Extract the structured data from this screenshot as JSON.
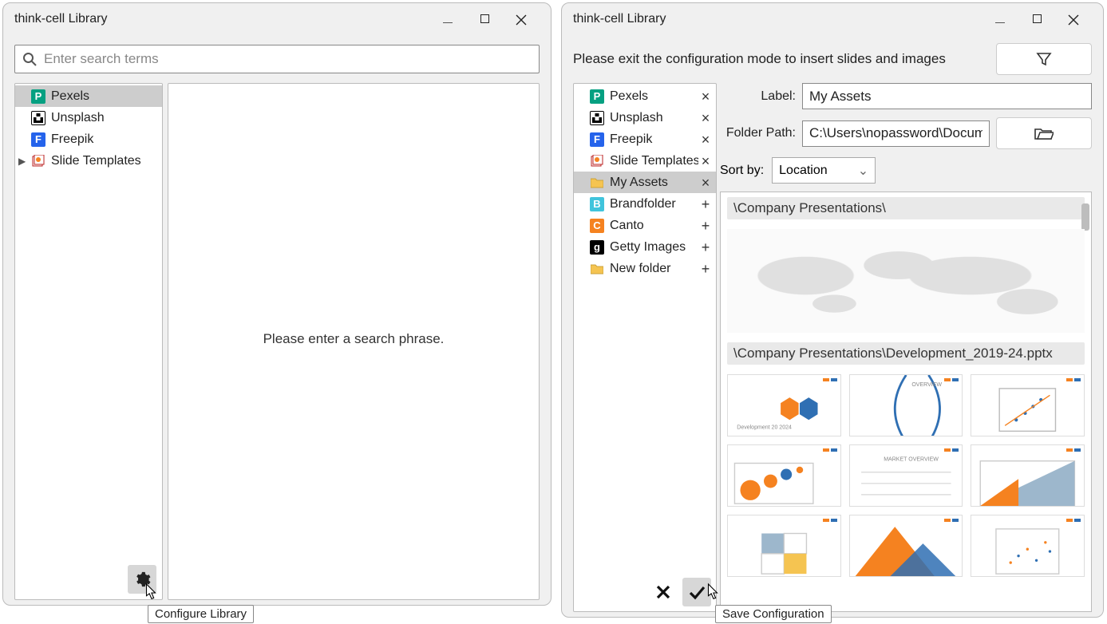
{
  "left": {
    "title": "think-cell Library",
    "search_placeholder": "Enter search terms",
    "tree": [
      {
        "label": "Pexels",
        "icon": "pexels",
        "selected": true
      },
      {
        "label": "Unsplash",
        "icon": "unsplash"
      },
      {
        "label": "Freepik",
        "icon": "freepik"
      },
      {
        "label": "Slide Templates",
        "icon": "slidetpl",
        "expandable": true
      }
    ],
    "placeholder_msg": "Please enter a search phrase.",
    "configure_tooltip": "Configure Library"
  },
  "right": {
    "title": "think-cell Library",
    "info_msg": "Please exit the configuration mode to insert slides and images",
    "sources": [
      {
        "label": "Pexels",
        "icon": "pexels",
        "action": "remove"
      },
      {
        "label": "Unsplash",
        "icon": "unsplash",
        "action": "remove"
      },
      {
        "label": "Freepik",
        "icon": "freepik",
        "action": "remove"
      },
      {
        "label": "Slide Templates",
        "icon": "slidetpl",
        "action": "remove"
      },
      {
        "label": "My Assets",
        "icon": "folder",
        "action": "remove",
        "selected": true
      },
      {
        "label": "Brandfolder",
        "icon": "brandfolder",
        "action": "add"
      },
      {
        "label": "Canto",
        "icon": "canto",
        "action": "add"
      },
      {
        "label": "Getty Images",
        "icon": "getty",
        "action": "add"
      },
      {
        "label": "New folder",
        "icon": "folder",
        "action": "add"
      }
    ],
    "form": {
      "label_label": "Label:",
      "label_value": "My Assets",
      "path_label": "Folder Path:",
      "path_value": "C:\\Users\\nopassword\\Documents",
      "sort_label": "Sort by:",
      "sort_value": "Location"
    },
    "groups": [
      {
        "header": "\\Company Presentations\\"
      },
      {
        "header": "\\Company Presentations\\Development_2019-24.pptx"
      }
    ],
    "save_tooltip": "Save Configuration"
  }
}
